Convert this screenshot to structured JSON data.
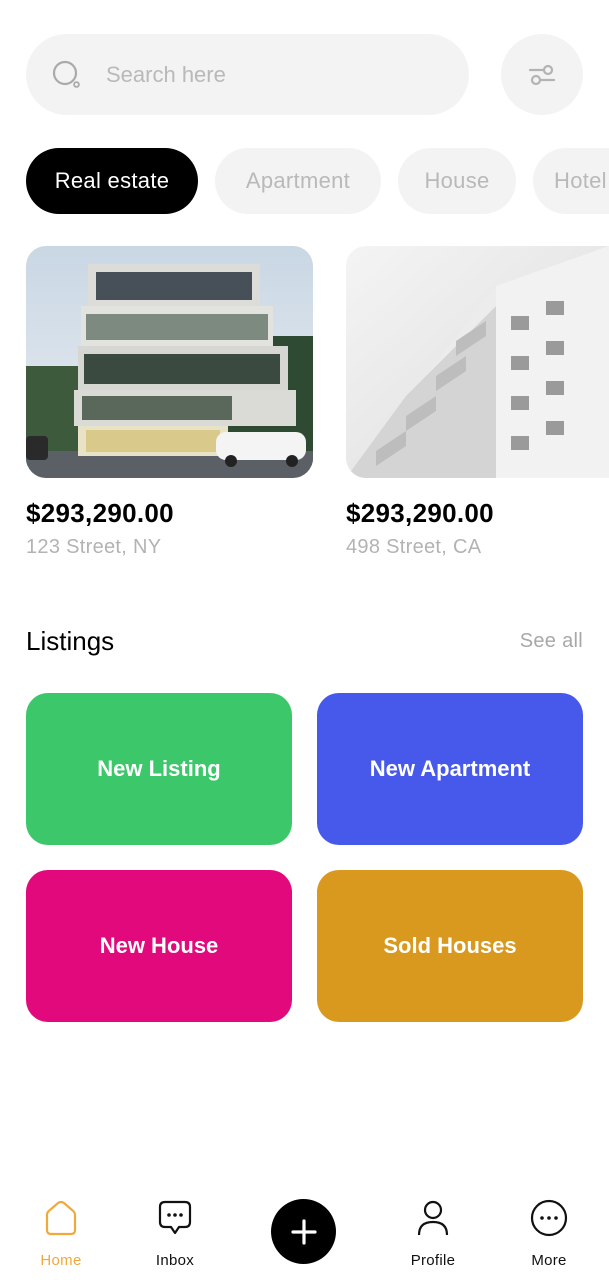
{
  "search": {
    "placeholder": "Search here"
  },
  "categories": [
    "Real estate",
    "Apartment",
    "House",
    "Hotel"
  ],
  "properties": [
    {
      "price": "$293,290.00",
      "address": "123 Street, NY"
    },
    {
      "price": "$293,290.00",
      "address": "498 Street, CA"
    }
  ],
  "listings": {
    "title": "Listings",
    "see_all": "See all",
    "tiles": [
      {
        "label": "New Listing",
        "color": "#3dc76b"
      },
      {
        "label": "New Apartment",
        "color": "#4659ea"
      },
      {
        "label": "New House",
        "color": "#e2097c"
      },
      {
        "label": "Sold Houses",
        "color": "#d9991e"
      }
    ]
  },
  "nav": {
    "home": "Home",
    "inbox": "Inbox",
    "profile": "Profile",
    "more": "More",
    "active_color": "#f0a93b"
  },
  "icons": [
    "search-icon",
    "filter-icon",
    "home-icon",
    "chat-icon",
    "plus-icon",
    "user-icon",
    "more-icon"
  ]
}
